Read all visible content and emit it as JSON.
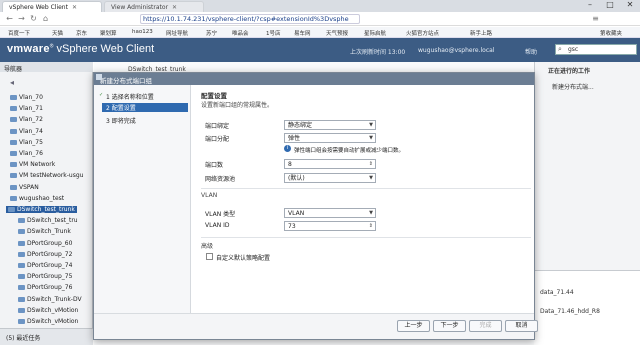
{
  "browser": {
    "tabs": [
      {
        "label": "vSphere Web Client",
        "active": true
      },
      {
        "label": "View Administrator",
        "active": false
      }
    ],
    "url": "https://10.1.74.231/vsphere-client/?csp#extensionId%3Dvsphe",
    "bookmarks": [
      "百度一下",
      "天猫",
      "京东",
      "聚划算",
      "hao123",
      "网址导航",
      "苏宁",
      "唯品会",
      "1号店",
      "易车网",
      "天气预报",
      "星际启航",
      "火狐官方站点",
      "新手上路",
      "第收藏夹"
    ]
  },
  "vsphere": {
    "brand": "vmware",
    "product": "vSphere Web Client",
    "header_items": [
      "上次刷新时间 13:00",
      "wugushao@vsphere.local",
      "帮助"
    ],
    "search_value": "gsc"
  },
  "navigator": {
    "title": "导航器",
    "items": [
      {
        "label": "Vlan_70",
        "selected": false
      },
      {
        "label": "Vlan_71",
        "selected": false
      },
      {
        "label": "Vlan_72",
        "selected": false
      },
      {
        "label": "Vlan_74",
        "selected": false
      },
      {
        "label": "Vlan_75",
        "selected": false
      },
      {
        "label": "Vlan_76",
        "selected": false
      },
      {
        "label": "VM Network",
        "selected": false
      },
      {
        "label": "VM testNetwork-usgu",
        "selected": false
      },
      {
        "label": "VSPAN",
        "selected": false
      },
      {
        "label": "wugushao_test",
        "selected": false
      },
      {
        "label": "DSwitch_test_trunk",
        "selected": true
      },
      {
        "label": "DSwitch_test_tru",
        "selected": false
      },
      {
        "label": "DSwitch_Trunk",
        "selected": false
      },
      {
        "label": "DPortGroup_60",
        "selected": false
      },
      {
        "label": "DPortGroup_72",
        "selected": false
      },
      {
        "label": "DPortGroup_74",
        "selected": false
      },
      {
        "label": "DPortGroup_75",
        "selected": false
      },
      {
        "label": "DPortGroup_76",
        "selected": false
      },
      {
        "label": "DSwitch_Trunk-DV",
        "selected": false
      },
      {
        "label": "DSwitch_vMotion",
        "selected": false
      },
      {
        "label": "DSwitch_vMotion",
        "selected": false
      }
    ],
    "footer": "(5) 最近任务"
  },
  "main": {
    "tab_label": "DSwitch_test_trunk"
  },
  "right_panel": {
    "title": "正在进行的工作",
    "item": "新建分布式端...",
    "log_items": [
      "data_71.44",
      "Data_71.46_hdd_R8"
    ]
  },
  "dialog": {
    "title": "新建分布式端口组",
    "steps": [
      "1 选择名称和位置",
      "2 配置设置",
      "3 即将完成"
    ],
    "selected_step": 1,
    "section_title": "配置设置",
    "section_subtitle": "设置新端口组的常规属性。",
    "port_binding_label": "端口绑定",
    "port_binding_value": "静态绑定",
    "port_allocation_label": "端口分配",
    "port_allocation_value": "弹性",
    "info_text": "弹性端口组会按需要自动扩展或减少端口数。",
    "num_ports_label": "端口数",
    "num_ports_value": "8",
    "network_resource_pool_label": "网络资源池",
    "network_resource_pool_value": "(默认)",
    "vlan_section": "VLAN",
    "vlan_type_label": "VLAN 类型",
    "vlan_type_value": "VLAN",
    "vlan_id_label": "VLAN ID",
    "vlan_id_value": "73",
    "advanced_section": "高级",
    "advanced_checkbox_label": "自定义默认策略配置",
    "buttons": {
      "back": "上一步",
      "next": "下一步",
      "finish": "完成",
      "cancel": "取消"
    }
  }
}
